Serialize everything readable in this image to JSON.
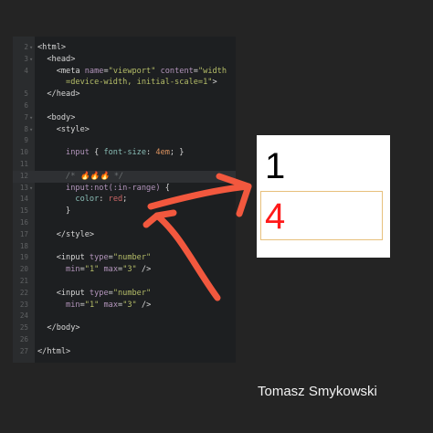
{
  "editor": {
    "lines": [
      {
        "n": "2",
        "fold": "▾",
        "segs": [
          {
            "t": "<html>",
            "c": "tk-tag"
          }
        ]
      },
      {
        "n": "3",
        "fold": "▾",
        "segs": [
          {
            "t": "  <head>",
            "c": "tk-tag"
          }
        ]
      },
      {
        "n": "4",
        "fold": "",
        "segs": [
          {
            "t": "    <meta ",
            "c": "tk-tag"
          },
          {
            "t": "name",
            "c": "tk-attr"
          },
          {
            "t": "=",
            "c": "tk-tag"
          },
          {
            "t": "\"viewport\"",
            "c": "tk-str"
          },
          {
            "t": " ",
            "c": "tk-tag"
          },
          {
            "t": "content",
            "c": "tk-attr"
          },
          {
            "t": "=",
            "c": "tk-tag"
          },
          {
            "t": "\"width",
            "c": "tk-str"
          }
        ]
      },
      {
        "n": "",
        "fold": "",
        "segs": [
          {
            "t": "      =device-width, initial-scale=1\"",
            "c": "tk-str"
          },
          {
            "t": ">",
            "c": "tk-tag"
          }
        ]
      },
      {
        "n": "5",
        "fold": "",
        "segs": [
          {
            "t": "  </head>",
            "c": "tk-tag"
          }
        ]
      },
      {
        "n": "6",
        "fold": "",
        "segs": []
      },
      {
        "n": "7",
        "fold": "▾",
        "segs": [
          {
            "t": "  <body>",
            "c": "tk-tag"
          }
        ]
      },
      {
        "n": "8",
        "fold": "▾",
        "segs": [
          {
            "t": "    <style>",
            "c": "tk-tag"
          }
        ]
      },
      {
        "n": "9",
        "fold": "",
        "segs": []
      },
      {
        "n": "10",
        "fold": "",
        "segs": [
          {
            "t": "      ",
            "c": "tk-tag"
          },
          {
            "t": "input",
            "c": "tk-sel"
          },
          {
            "t": " { ",
            "c": "tk-tag"
          },
          {
            "t": "font-size",
            "c": "tk-prop"
          },
          {
            "t": ": ",
            "c": "tk-tag"
          },
          {
            "t": "4em",
            "c": "tk-num"
          },
          {
            "t": "; }",
            "c": "tk-tag"
          }
        ]
      },
      {
        "n": "11",
        "fold": "",
        "segs": []
      },
      {
        "n": "12",
        "fold": "",
        "hl": true,
        "segs": [
          {
            "t": "      /* 🔥🔥🔥 */",
            "c": "tk-cm"
          }
        ]
      },
      {
        "n": "13",
        "fold": "▾",
        "segs": [
          {
            "t": "      ",
            "c": "tk-tag"
          },
          {
            "t": "input:not(:in-range)",
            "c": "tk-sel"
          },
          {
            "t": " {",
            "c": "tk-tag"
          }
        ]
      },
      {
        "n": "14",
        "fold": "",
        "segs": [
          {
            "t": "        ",
            "c": "tk-tag"
          },
          {
            "t": "color",
            "c": "tk-prop"
          },
          {
            "t": ": ",
            "c": "tk-tag"
          },
          {
            "t": "red",
            "c": "tk-red"
          },
          {
            "t": ";",
            "c": "tk-tag"
          }
        ]
      },
      {
        "n": "15",
        "fold": "",
        "segs": [
          {
            "t": "      }",
            "c": "tk-tag"
          }
        ]
      },
      {
        "n": "16",
        "fold": "",
        "segs": []
      },
      {
        "n": "17",
        "fold": "",
        "segs": [
          {
            "t": "    </style>",
            "c": "tk-tag"
          }
        ]
      },
      {
        "n": "18",
        "fold": "",
        "segs": []
      },
      {
        "n": "19",
        "fold": "",
        "segs": [
          {
            "t": "    <input ",
            "c": "tk-tag"
          },
          {
            "t": "type",
            "c": "tk-attr"
          },
          {
            "t": "=",
            "c": "tk-tag"
          },
          {
            "t": "\"number\"",
            "c": "tk-str"
          }
        ]
      },
      {
        "n": "20",
        "fold": "",
        "segs": [
          {
            "t": "      ",
            "c": "tk-tag"
          },
          {
            "t": "min",
            "c": "tk-attr"
          },
          {
            "t": "=",
            "c": "tk-tag"
          },
          {
            "t": "\"1\"",
            "c": "tk-str"
          },
          {
            "t": " ",
            "c": "tk-tag"
          },
          {
            "t": "max",
            "c": "tk-attr"
          },
          {
            "t": "=",
            "c": "tk-tag"
          },
          {
            "t": "\"3\"",
            "c": "tk-str"
          },
          {
            "t": " />",
            "c": "tk-tag"
          }
        ]
      },
      {
        "n": "21",
        "fold": "",
        "segs": []
      },
      {
        "n": "22",
        "fold": "",
        "segs": [
          {
            "t": "    <input ",
            "c": "tk-tag"
          },
          {
            "t": "type",
            "c": "tk-attr"
          },
          {
            "t": "=",
            "c": "tk-tag"
          },
          {
            "t": "\"number\"",
            "c": "tk-str"
          }
        ]
      },
      {
        "n": "23",
        "fold": "",
        "segs": [
          {
            "t": "      ",
            "c": "tk-tag"
          },
          {
            "t": "min",
            "c": "tk-attr"
          },
          {
            "t": "=",
            "c": "tk-tag"
          },
          {
            "t": "\"1\"",
            "c": "tk-str"
          },
          {
            "t": " ",
            "c": "tk-tag"
          },
          {
            "t": "max",
            "c": "tk-attr"
          },
          {
            "t": "=",
            "c": "tk-tag"
          },
          {
            "t": "\"3\"",
            "c": "tk-str"
          },
          {
            "t": " />",
            "c": "tk-tag"
          }
        ]
      },
      {
        "n": "24",
        "fold": "",
        "segs": []
      },
      {
        "n": "25",
        "fold": "",
        "segs": [
          {
            "t": "  </body>",
            "c": "tk-tag"
          }
        ]
      },
      {
        "n": "26",
        "fold": "",
        "segs": []
      },
      {
        "n": "27",
        "fold": "",
        "segs": [
          {
            "t": "</html>",
            "c": "tk-tag"
          }
        ]
      }
    ]
  },
  "preview": {
    "input_1_value": "1",
    "input_2_value": "4",
    "out_of_range_color": "#ff1a1a",
    "focus_border_color": "#e7c07c"
  },
  "annotation": {
    "arrow_color": "#f2583e"
  },
  "author": "Tomasz Smykowski"
}
